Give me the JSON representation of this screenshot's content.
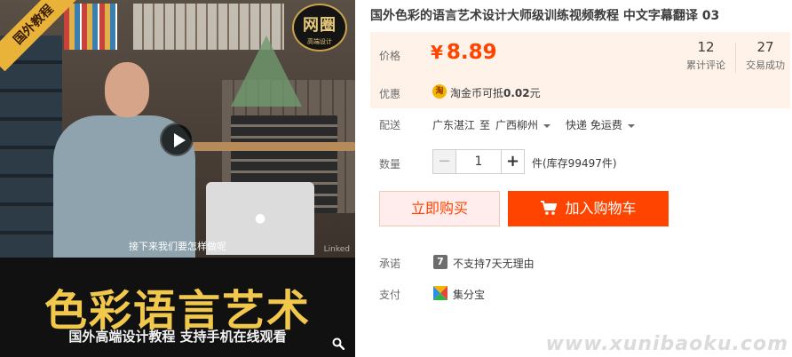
{
  "media": {
    "corner_tag": "国外教程",
    "seal_main": "网圈",
    "seal_sub": "高端设计",
    "subtitle": "接下来我们要怎样做呢",
    "watermark": "Linked",
    "banner_title": "色彩语言艺术",
    "banner_sub": "国外高端设计教程  支持手机在线观看",
    "icons": {
      "play": "play-icon",
      "zoom": "magnifier-icon",
      "laptop_logo": "apple-icon"
    }
  },
  "product": {
    "title": "国外色彩的语言艺术设计大师级训练视频教程 中文字幕翻译 03"
  },
  "price": {
    "label": "价格",
    "currency": "¥",
    "value": "8.89",
    "reviews_count": "12",
    "reviews_label": "累计评论",
    "sales_count": "27",
    "sales_label": "交易成功"
  },
  "promo": {
    "label": "优惠",
    "coin_glyph": "淘",
    "text_prefix": "淘金币可抵",
    "amount": "0.02",
    "text_suffix": "元"
  },
  "shipping": {
    "label": "配送",
    "origin": "广东湛江",
    "to": "至",
    "destination": "广西柳州",
    "method": "快递 免运费"
  },
  "quantity": {
    "label": "数量",
    "minus": "−",
    "plus": "+",
    "value": "1",
    "unit_stock": "件(库存99497件)"
  },
  "actions": {
    "buy_now": "立即购买",
    "add_cart": "加入购物车"
  },
  "promise": {
    "label": "承诺",
    "icon_glyph": "7",
    "text": "不支持7天无理由"
  },
  "payment": {
    "label": "支付",
    "text": "集分宝"
  },
  "site_watermark": "www.xunibaoku.com",
  "colors": {
    "accent": "#ff4400",
    "price_bg": "#fff2e8",
    "banner_gold": "#f1c84b"
  }
}
